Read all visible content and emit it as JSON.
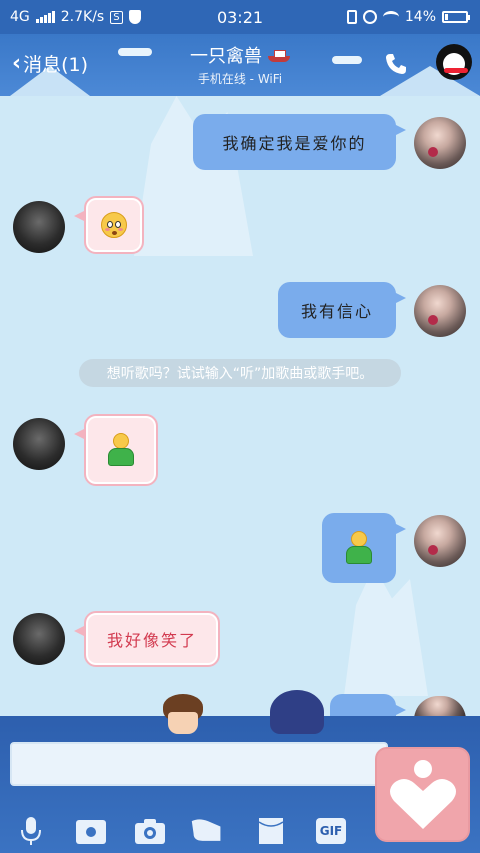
{
  "status_bar": {
    "network": "4G",
    "speed": "2.7K/s",
    "time": "03:21",
    "battery": "14%",
    "battery_level": 0.14
  },
  "header": {
    "back_label": "消息(1)",
    "title": "一只禽兽",
    "subtitle": "手机在线 - WiFi"
  },
  "messages": [
    {
      "side": "out",
      "type": "text",
      "text": "我确定我是爱你的"
    },
    {
      "side": "in",
      "type": "emoji",
      "emoji": "flushed-face"
    },
    {
      "side": "out",
      "type": "text",
      "text": "我有信心"
    },
    {
      "side": "system",
      "type": "tip",
      "text": "想听歌吗？试试输入“听”加歌曲或歌手吧。"
    },
    {
      "side": "in",
      "type": "emoji",
      "emoji": "person-emoji"
    },
    {
      "side": "out",
      "type": "emoji",
      "emoji": "person-emoji"
    },
    {
      "side": "in",
      "type": "text",
      "text": "我好像笑了"
    }
  ],
  "input": {
    "placeholder": ""
  },
  "toolbar": {
    "items": [
      "mic-icon",
      "photo-icon",
      "camera-icon",
      "hongbao-icon",
      "file-icon",
      "gif-icon"
    ],
    "gif_label": "GIF"
  },
  "colors": {
    "header_bg": "#3a78c8",
    "out_bubble": "#7aacec",
    "in_bubble_bg": "#fde7ea",
    "in_bubble_text": "#d23a4f",
    "send_button": "#f0a5ab"
  }
}
